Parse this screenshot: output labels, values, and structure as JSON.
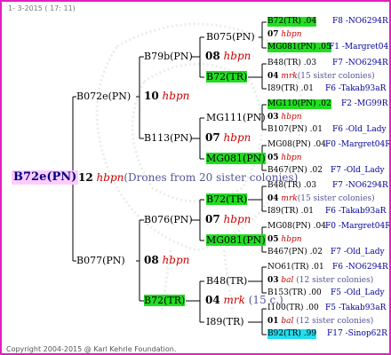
{
  "header": "1-  3-2015 ( 17: 11)",
  "footer": "Copyright 2004-2015 @ Karl Kehrle Foundation.",
  "root": {
    "label": "B72e(PN)",
    "year": "12",
    "mark": "hbpn",
    "note": "(Drones from 20 sister colonies)"
  },
  "g1": [
    {
      "label": "B072e(PN)",
      "year": "10",
      "mark": "hbpn"
    },
    {
      "label": "B077(PN)",
      "year": "08",
      "mark": "hbpn"
    }
  ],
  "g2": [
    {
      "label": "B79b(PN)",
      "year": "08",
      "mark": "hbpn"
    },
    {
      "label": "B113(PN)",
      "year": "07",
      "mark": "hbpn"
    },
    {
      "label": "B076(PN)",
      "year": "07",
      "mark": "hbpn"
    },
    {
      "label": "B72(TR)",
      "year": "04",
      "mark": "mrk",
      "note": "(15 c.)"
    }
  ],
  "g3": [
    {
      "label": "B075(PN)",
      "year": "07",
      "mark": "hbpn"
    },
    {
      "label": "B72(TR)",
      "year": "",
      "mark": ""
    },
    {
      "label": "MG111(PN)",
      "year": "03",
      "mark": "hbpn"
    },
    {
      "label": "MG081(PN)",
      "year": "",
      "mark": ""
    },
    {
      "label": "B72(TR)",
      "year": "",
      "mark": ""
    },
    {
      "label": "MG081(PN)",
      "year": "",
      "mark": ""
    },
    {
      "label": "B48(TR)",
      "year": "04",
      "mark": "mrk"
    },
    {
      "label": "I89(TR)",
      "year": "",
      "mark": ""
    }
  ],
  "g4": [
    {
      "a": "B72(TR) .04",
      "a_ref": "F8 -NO6294R",
      "year": "07",
      "mark": "hbpn",
      "note": "",
      "b": "MG081(PN) .05",
      "b_ref": "F1 -Margret04R"
    },
    {
      "a": "B48(TR) .03",
      "a_ref": "F7 -NO6294R",
      "year": "04",
      "mark": "mrk",
      "note": "(15 sister colonies)",
      "b": "I89(TR) .01",
      "b_ref": "F6 -Takab93aR"
    },
    {
      "a": "MG110(PN) .02",
      "a_ref": "F2 -MG99R",
      "year": "03",
      "mark": "hbpn",
      "note": "",
      "b": "B107(PN) .01",
      "b_ref": "F6 -Old_Lady"
    },
    {
      "a": "MG08(PN) .04",
      "a_ref": "F0 -Margret04R",
      "year": "05",
      "mark": "hbpn",
      "note": "",
      "b": "B467(PN) .02",
      "b_ref": "F7 -Old_Lady"
    },
    {
      "a": "B48(TR) .03",
      "a_ref": "F7 -NO6294R",
      "year": "04",
      "mark": "mrk",
      "note": "(15 sister colonies)",
      "b": "I89(TR) .01",
      "b_ref": "F6 -Takab93aR"
    },
    {
      "a": "MG08(PN) .04",
      "a_ref": "F0 -Margret04R",
      "year": "05",
      "mark": "hbpn",
      "note": "",
      "b": "B467(PN) .02",
      "b_ref": "F7 -Old_Lady"
    },
    {
      "a": "NO61(TR) .01",
      "a_ref": "F6 -NO6294R",
      "year": "03",
      "mark": "bal",
      "note": "(12 sister colonies)",
      "b": "B153(TR) .00",
      "b_ref": "F5 -Old_Lady"
    },
    {
      "a": "I100(TR) .00",
      "a_ref": "F5 -Takab93aR",
      "year": "01",
      "mark": "bal",
      "note": "(12 sister colonies)",
      "b": "B92(TR) .99",
      "b_ref": "F17 -Sinop62R"
    }
  ]
}
